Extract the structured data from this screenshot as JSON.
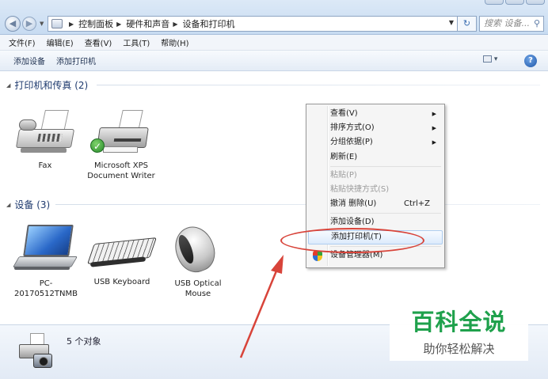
{
  "address_bar": {
    "breadcrumbs": [
      "控制面板",
      "硬件和声音",
      "设备和打印机"
    ],
    "search_placeholder": "搜索 设备..."
  },
  "menu_bar": [
    "文件(F)",
    "编辑(E)",
    "查看(V)",
    "工具(T)",
    "帮助(H)"
  ],
  "command_bar": {
    "add_device": "添加设备",
    "add_printer": "添加打印机"
  },
  "groups": {
    "printers": {
      "title": "打印机和传真 (2)",
      "items": [
        {
          "label": "Fax",
          "icon": "fax-icon"
        },
        {
          "label": "Microsoft XPS Document Writer",
          "icon": "printer-icon",
          "default": true
        }
      ]
    },
    "devices": {
      "title": "设备 (3)",
      "items": [
        {
          "label": "PC-20170512TNMB",
          "icon": "laptop-icon"
        },
        {
          "label": "USB Keyboard",
          "icon": "keyboard-icon"
        },
        {
          "label": "USB Optical Mouse",
          "icon": "mouse-icon"
        }
      ]
    }
  },
  "details_pane": {
    "count": "5 个对象"
  },
  "context_menu": {
    "items": [
      {
        "label": "查看(V)",
        "submenu": true,
        "enabled": true
      },
      {
        "label": "排序方式(O)",
        "submenu": true,
        "enabled": true
      },
      {
        "label": "分组依据(P)",
        "submenu": true,
        "enabled": true
      },
      {
        "label": "刷新(E)",
        "enabled": true
      },
      {
        "label": "粘贴(P)",
        "enabled": false
      },
      {
        "label": "粘贴快捷方式(S)",
        "enabled": false
      },
      {
        "label": "撤消 删除(U)",
        "shortcut": "Ctrl+Z",
        "enabled": true
      },
      {
        "label": "添加设备(D)",
        "enabled": true
      },
      {
        "label": "添加打印机(T)",
        "enabled": true,
        "highlighted": true
      },
      {
        "label": "设备管理器(M)",
        "enabled": true,
        "icon": "shield-icon"
      }
    ]
  },
  "watermark": {
    "logo": "百科全说",
    "sub": "助你轻松解决"
  },
  "colors": {
    "annotation": "#d8443a",
    "watermark_green": "#1fa14c",
    "link": "#1e3a6e"
  }
}
